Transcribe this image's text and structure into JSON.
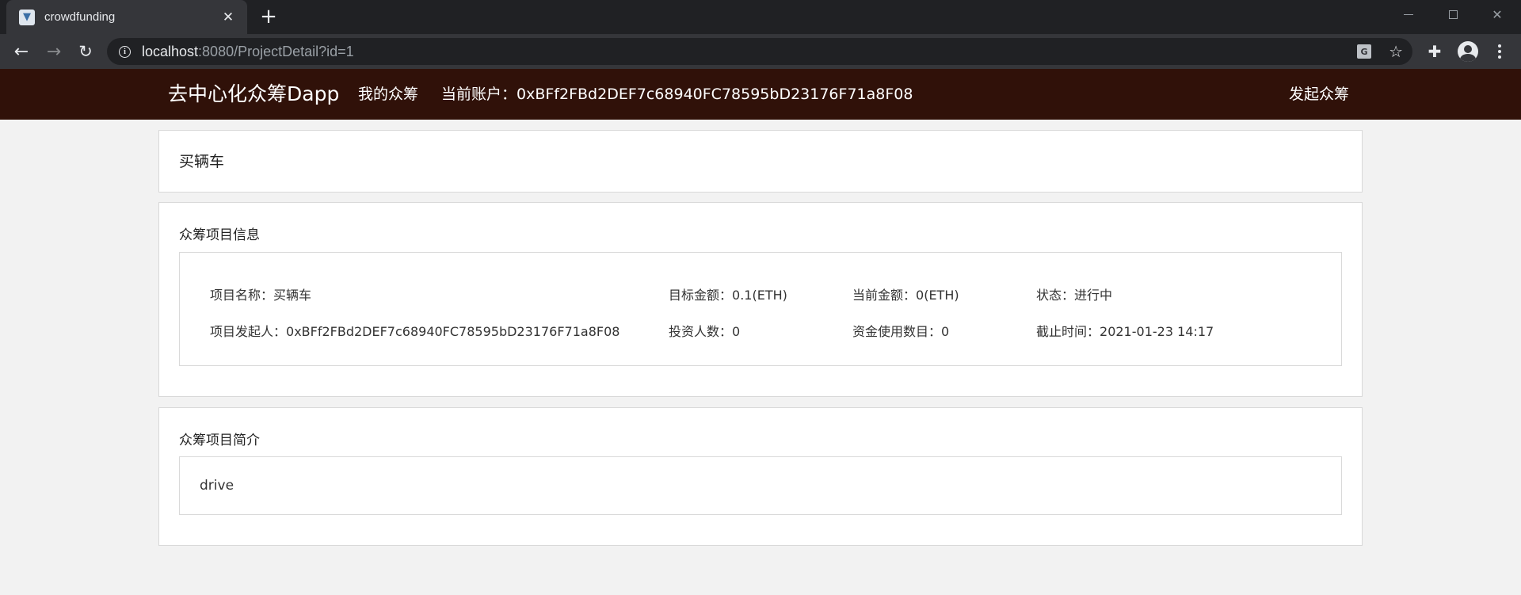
{
  "browser": {
    "tab_title": "crowdfunding",
    "tab_close": "✕",
    "new_tab": "+",
    "url_host": "localhost",
    "url_rest": ":8080/ProjectDetail?id=1"
  },
  "navbar": {
    "brand": "去中心化众筹Dapp",
    "my_crowdfunding": "我的众筹",
    "account_label": "当前账户：",
    "account_address": "0xBFf2FBd2DEF7c68940FC78595bD23176F71a8F08",
    "launch": "发起众筹"
  },
  "project": {
    "title": "买辆车"
  },
  "info_section": {
    "heading": "众筹项目信息",
    "fields": [
      {
        "label": "项目名称：",
        "value": "买辆车"
      },
      {
        "label": "目标金额：",
        "value": "0.1(ETH)"
      },
      {
        "label": "当前金额：",
        "value": "0(ETH)"
      },
      {
        "label": "状态：",
        "value": "进行中"
      },
      {
        "label": "项目发起人：",
        "value": "0xBFf2FBd2DEF7c68940FC78595bD23176F71a8F08"
      },
      {
        "label": "投资人数：",
        "value": "0"
      },
      {
        "label": "资金使用数目：",
        "value": "0"
      },
      {
        "label": "截止时间：",
        "value": "2021-01-23 14:17"
      }
    ]
  },
  "intro_section": {
    "heading": "众筹项目简介",
    "text": "drive"
  }
}
